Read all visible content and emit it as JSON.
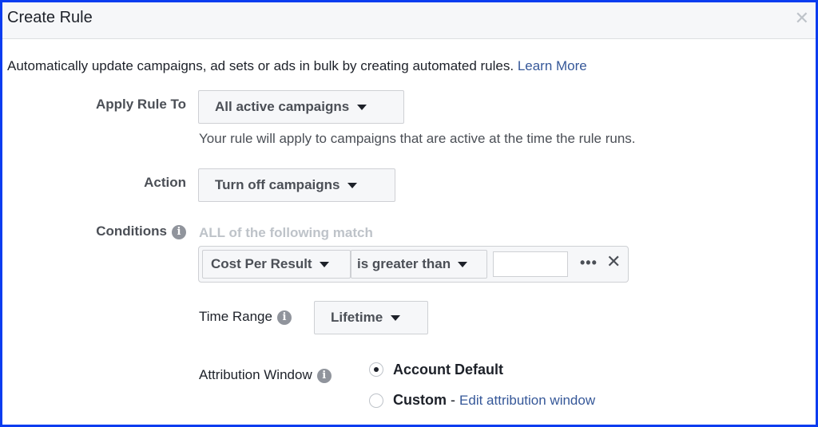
{
  "dialog": {
    "title": "Create Rule",
    "close_icon": "close-icon",
    "intro_text": "Automatically update campaigns, ad sets or ads in bulk by creating automated rules.",
    "learn_more": "Learn More"
  },
  "apply_rule": {
    "label": "Apply Rule To",
    "selected": "All active campaigns",
    "helper": "Your rule will apply to campaigns that are active at the time the rule runs."
  },
  "action": {
    "label": "Action",
    "selected": "Turn off campaigns"
  },
  "conditions": {
    "label": "Conditions",
    "match_hint": "ALL of the following match",
    "metric": "Cost Per Result",
    "operator": "is greater than",
    "value": "",
    "more_icon": "ellipsis-icon",
    "remove_icon": "close-icon"
  },
  "time_range": {
    "label": "Time Range",
    "selected": "Lifetime"
  },
  "attribution": {
    "label": "Attribution Window",
    "options": [
      {
        "label": "Account Default",
        "checked": true
      },
      {
        "label": "Custom",
        "checked": false
      }
    ],
    "separator": "-",
    "edit_link": "Edit attribution window"
  },
  "colors": {
    "frame_border": "#0a3cf0",
    "link": "#365899",
    "muted": "#bec3c9"
  }
}
